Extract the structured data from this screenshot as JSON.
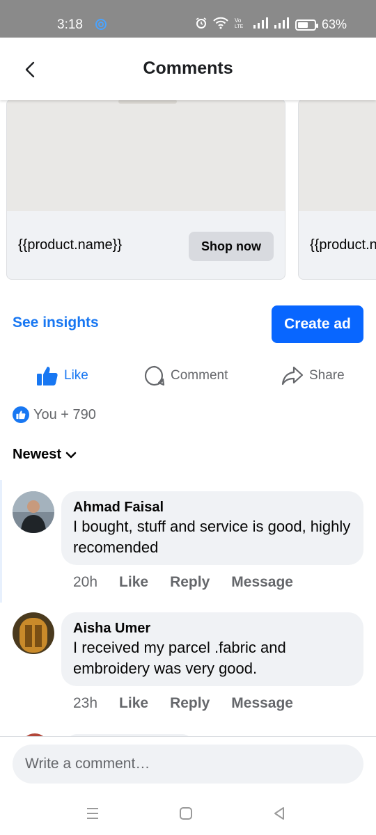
{
  "status_bar": {
    "time": "3:18",
    "battery": "63%",
    "battery_level": 0.63,
    "icons": [
      "app-icon",
      "alarm-icon",
      "wifi-icon",
      "volte-icon",
      "signal-icon",
      "signal-icon",
      "battery-icon"
    ]
  },
  "header": {
    "title": "Comments",
    "back_icon": "chevron-left-icon"
  },
  "products": [
    {
      "name": "{{product.name}}",
      "button": "Shop now"
    },
    {
      "name": "{{product.name}}"
    }
  ],
  "post_actions": {
    "see_insights": "See insights",
    "create_ad": "Create ad"
  },
  "reactions": {
    "like": "Like",
    "comment": "Comment",
    "share": "Share"
  },
  "likes_summary": "You + 790",
  "sort": {
    "label": "Newest",
    "icon": "chevron-down-icon"
  },
  "comments": [
    {
      "author": "Ahmad Faisal",
      "text": "I bought, stuff and service is good, highly recomended",
      "time": "20h",
      "like": "Like",
      "reply": "Reply",
      "message": "Message"
    },
    {
      "author": "Aisha Umer",
      "text": "I received my parcel .fabric and embroidery was very good.",
      "time": "23h",
      "like": "Like",
      "reply": "Reply",
      "message": "Message"
    }
  ],
  "composer": {
    "placeholder": "Write a comment…"
  },
  "colors": {
    "accent": "#1877f2",
    "primary_button": "#0866ff",
    "bubble": "#f0f2f5",
    "secondary_text": "#65676b"
  }
}
